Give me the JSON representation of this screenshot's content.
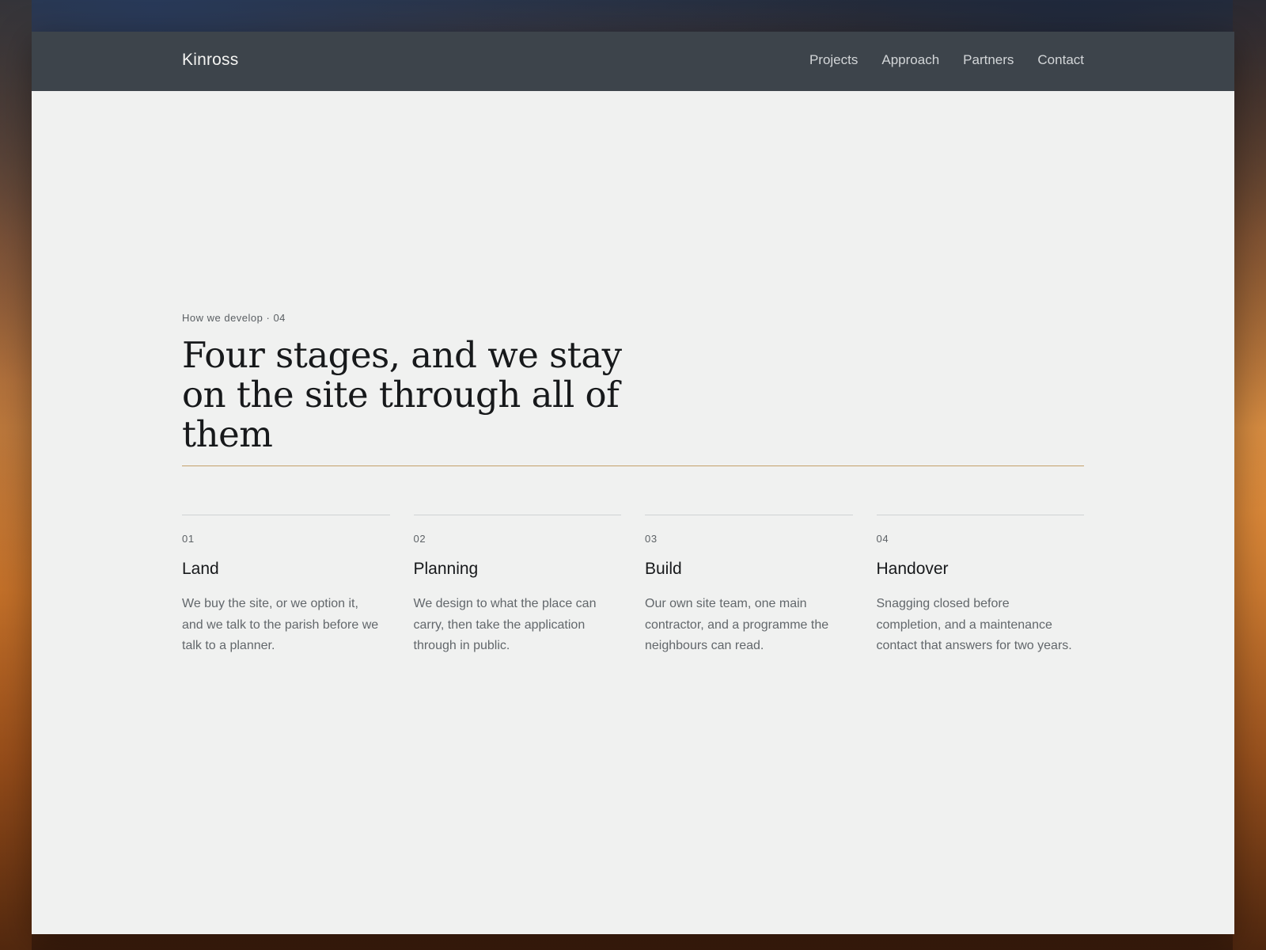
{
  "header": {
    "brand": "Kinross",
    "nav": [
      "Projects",
      "Approach",
      "Partners",
      "Contact"
    ]
  },
  "section": {
    "eyebrow": "How we develop · 04",
    "headline": "Four stages, and we stay on the site through all of them"
  },
  "stages": [
    {
      "number": "01",
      "title": "Land",
      "body": "We buy the site, or we option it, and we talk to the parish before we talk to a planner."
    },
    {
      "number": "02",
      "title": "Planning",
      "body": "We design to what the place can carry, then take the application through in public."
    },
    {
      "number": "03",
      "title": "Build",
      "body": "Our own site team, one main contractor, and a programme the neighbours can read."
    },
    {
      "number": "04",
      "title": "Handover",
      "body": "Snagging closed before completion, and a maintenance contact that answers for two years."
    }
  ],
  "colors": {
    "header_bg": "#3d444b",
    "page_bg": "#f0f1f0",
    "accent_rule": "#c4a06a"
  }
}
